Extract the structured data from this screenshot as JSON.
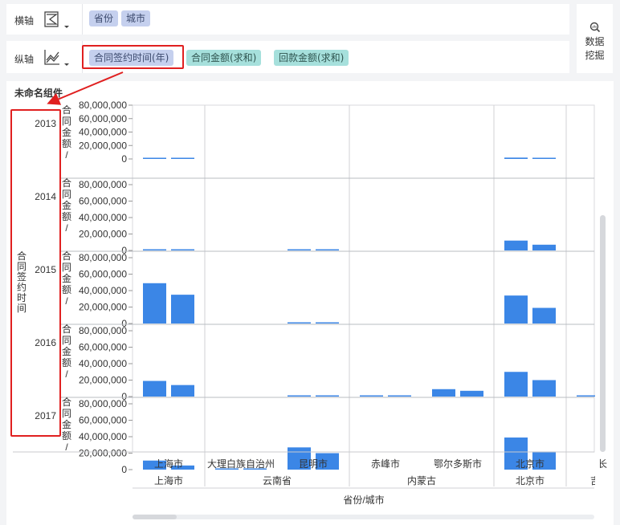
{
  "x_axis": {
    "label": "横轴",
    "icon": "horizontal-axis-chart-icon",
    "fields": [
      "省份",
      "城市"
    ]
  },
  "y_axis": {
    "label": "纵轴",
    "icon": "vertical-axis-chart-icon",
    "fields": [
      "合同签约时间(年)",
      "合同金额(求和)",
      "回款金额(求和)"
    ]
  },
  "data_mining": {
    "icon": "data-mining-icon",
    "line1": "数据",
    "line2": "挖掘"
  },
  "chart_title": "未命名组件",
  "colors": {
    "bar": "#3b86e6",
    "highlight": "#e02020",
    "pill_dim": "#c5d0ee",
    "pill_measure": "#a6e0dc"
  },
  "chart_data": {
    "type": "bar",
    "row_dimension": "合同签约时间",
    "rows": [
      "2013",
      "2014",
      "2015",
      "2016",
      "2017"
    ],
    "y_axis_label": "合同金额/...",
    "y_ticks": [
      "80,000,000",
      "60,000,000",
      "40,000,000",
      "20,000,000",
      "0"
    ],
    "ylim": [
      0,
      80000000
    ],
    "x_axis_title": "省份/城市",
    "cities": [
      {
        "city": "上海市",
        "province": "上海市"
      },
      {
        "city": "大理白族自治州",
        "province": "云南省"
      },
      {
        "city": "昆明市",
        "province": "云南省"
      },
      {
        "city": "赤峰市",
        "province": "内蒙古"
      },
      {
        "city": "鄂尔多斯市",
        "province": "内蒙古"
      },
      {
        "city": "北京市",
        "province": "北京市"
      },
      {
        "city": "长",
        "province": "吉"
      }
    ],
    "provinces": [
      "上海市",
      "云南省",
      "内蒙古",
      "北京市",
      "吉"
    ],
    "series": [
      {
        "measure": "合同金额(求和)",
        "values": [
          [
            1000000,
            0,
            0,
            0,
            0,
            2000000,
            0
          ],
          [
            1000000,
            0,
            1000000,
            0,
            0,
            12000000,
            0
          ],
          [
            49000000,
            0,
            1000000,
            0,
            0,
            34000000,
            0
          ],
          [
            19000000,
            0,
            1000000,
            1000000,
            9000000,
            30000000,
            1000000
          ],
          [
            11000000,
            1000000,
            27000000,
            0,
            0,
            39000000,
            0
          ]
        ]
      },
      {
        "measure": "回款金额(求和)",
        "values": [
          [
            1000000,
            0,
            0,
            0,
            0,
            1000000,
            0
          ],
          [
            1000000,
            0,
            1000000,
            0,
            0,
            7000000,
            0
          ],
          [
            35000000,
            0,
            1000000,
            0,
            0,
            19000000,
            0
          ],
          [
            14000000,
            0,
            1000000,
            1000000,
            7000000,
            20000000,
            0
          ],
          [
            5000000,
            1000000,
            20000000,
            0,
            0,
            22000000,
            0
          ]
        ]
      }
    ]
  }
}
